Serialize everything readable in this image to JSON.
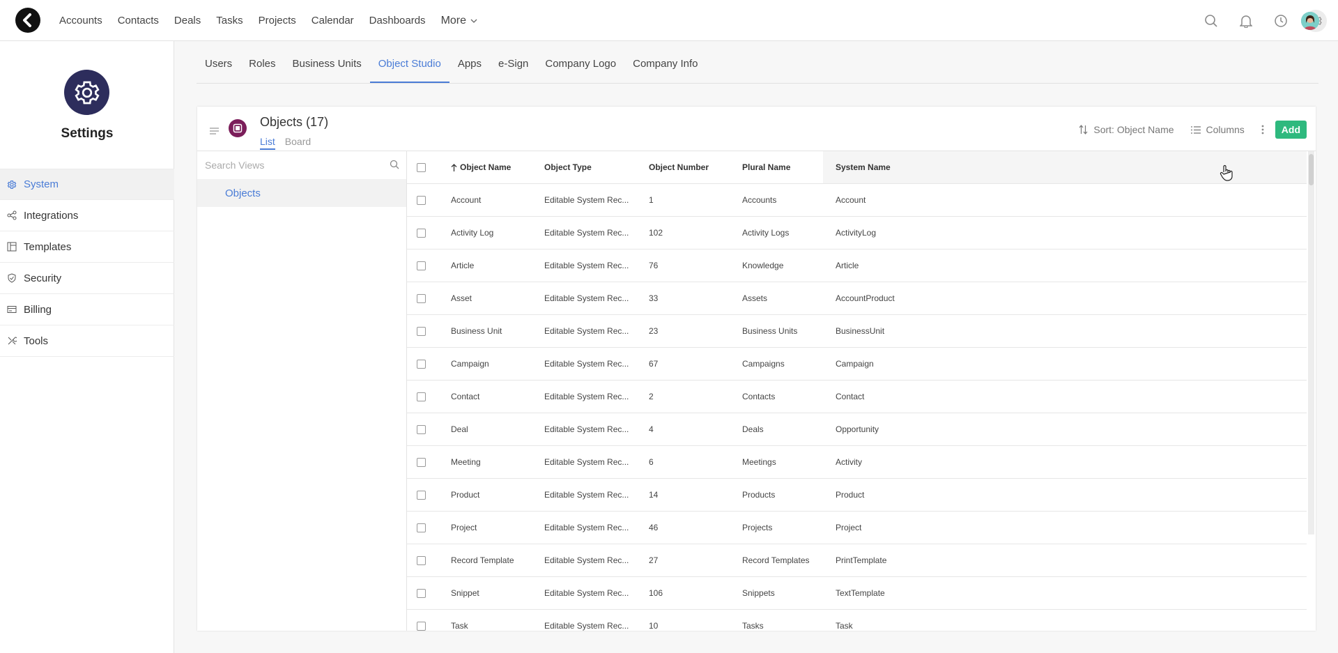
{
  "topnav": {
    "items": [
      "Accounts",
      "Contacts",
      "Deals",
      "Tasks",
      "Projects",
      "Calendar",
      "Dashboards"
    ],
    "more_label": "More"
  },
  "sidebar": {
    "title": "Settings",
    "items": [
      {
        "label": "System",
        "icon": "gear-icon",
        "active": true
      },
      {
        "label": "Integrations",
        "icon": "share-icon",
        "active": false
      },
      {
        "label": "Templates",
        "icon": "template-icon",
        "active": false
      },
      {
        "label": "Security",
        "icon": "shield-icon",
        "active": false
      },
      {
        "label": "Billing",
        "icon": "billing-icon",
        "active": false
      },
      {
        "label": "Tools",
        "icon": "tools-icon",
        "active": false
      }
    ]
  },
  "subtabs": [
    "Users",
    "Roles",
    "Business Units",
    "Object Studio",
    "Apps",
    "e-Sign",
    "Company Logo",
    "Company Info"
  ],
  "subtabs_active": "Object Studio",
  "panel": {
    "title": "Objects",
    "count": "(17)",
    "view_tabs": [
      "List",
      "Board"
    ],
    "sort_label": "Sort: Object Name",
    "columns_label": "Columns",
    "add_label": "Add"
  },
  "views": {
    "search_placeholder": "Search Views",
    "items": [
      "Objects"
    ]
  },
  "table": {
    "headers": [
      "Object Name",
      "Object Type",
      "Object Number",
      "Plural Name",
      "System Name"
    ],
    "rows": [
      [
        "Account",
        "Editable System Rec...",
        "1",
        "Accounts",
        "Account"
      ],
      [
        "Activity Log",
        "Editable System Rec...",
        "102",
        "Activity Logs",
        "ActivityLog"
      ],
      [
        "Article",
        "Editable System Rec...",
        "76",
        "Knowledge",
        "Article"
      ],
      [
        "Asset",
        "Editable System Rec...",
        "33",
        "Assets",
        "AccountProduct"
      ],
      [
        "Business Unit",
        "Editable System Rec...",
        "23",
        "Business Units",
        "BusinessUnit"
      ],
      [
        "Campaign",
        "Editable System Rec...",
        "67",
        "Campaigns",
        "Campaign"
      ],
      [
        "Contact",
        "Editable System Rec...",
        "2",
        "Contacts",
        "Contact"
      ],
      [
        "Deal",
        "Editable System Rec...",
        "4",
        "Deals",
        "Opportunity"
      ],
      [
        "Meeting",
        "Editable System Rec...",
        "6",
        "Meetings",
        "Activity"
      ],
      [
        "Product",
        "Editable System Rec...",
        "14",
        "Products",
        "Product"
      ],
      [
        "Project",
        "Editable System Rec...",
        "46",
        "Projects",
        "Project"
      ],
      [
        "Record Template",
        "Editable System Rec...",
        "27",
        "Record Templates",
        "PrintTemplate"
      ],
      [
        "Snippet",
        "Editable System Rec...",
        "106",
        "Snippets",
        "TextTemplate"
      ],
      [
        "Task",
        "Editable System Rec...",
        "10",
        "Tasks",
        "Task"
      ]
    ]
  },
  "colors": {
    "accent": "#4a7cd6",
    "add_button": "#2eb97e",
    "settings_badge": "#2d2d5c",
    "object_icon": "#7b1e5a"
  }
}
